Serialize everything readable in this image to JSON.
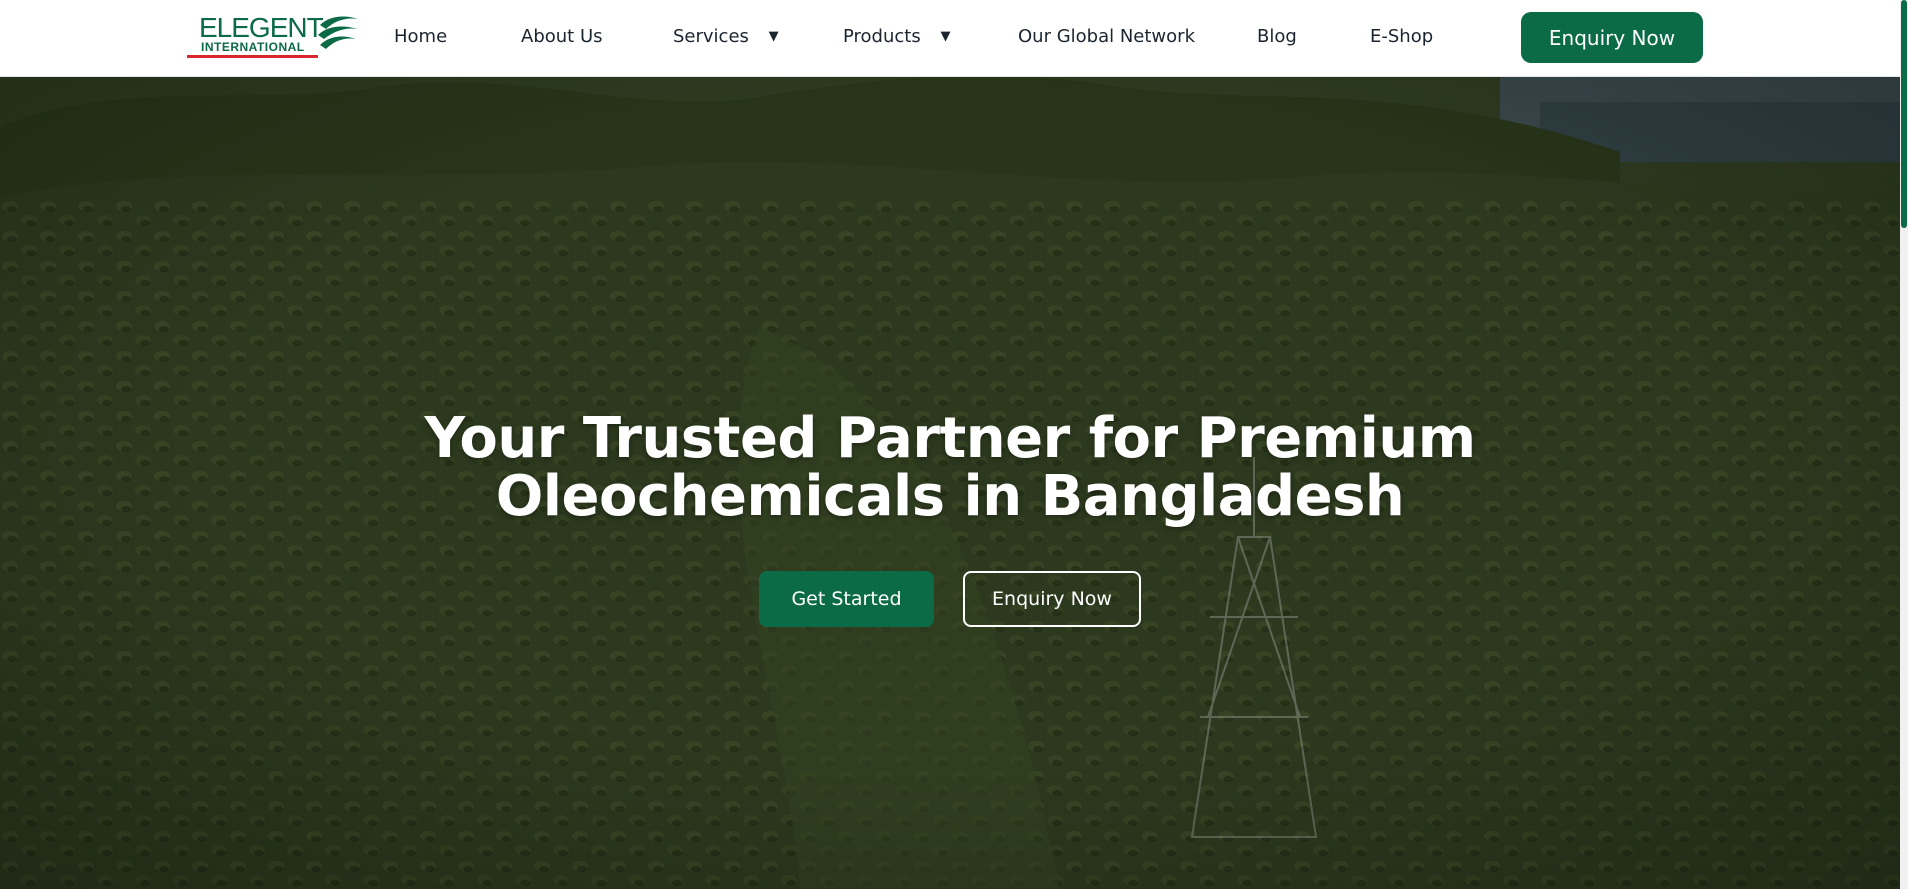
{
  "brand": {
    "name_top": "ELEGENT",
    "name_bottom": "INTERNATIONAL"
  },
  "nav": {
    "items": [
      {
        "label": "Home"
      },
      {
        "label": "About Us"
      },
      {
        "label": "Services",
        "dropdown": true
      },
      {
        "label": "Products",
        "dropdown": true
      },
      {
        "label": "Our Global Network"
      },
      {
        "label": "Blog"
      },
      {
        "label": "E-Shop"
      }
    ],
    "caret": "▼",
    "cta_label": "Enquiry Now"
  },
  "hero": {
    "title_line1": "Your Trusted Partner for Premium",
    "title_line2": "Oleochemicals in Bangladesh",
    "primary_label": "Get Started",
    "secondary_label": "Enquiry Now"
  },
  "colors": {
    "brand_green": "#0b6b47",
    "accent_red": "#d9262e",
    "nav_text": "#1c2430"
  }
}
